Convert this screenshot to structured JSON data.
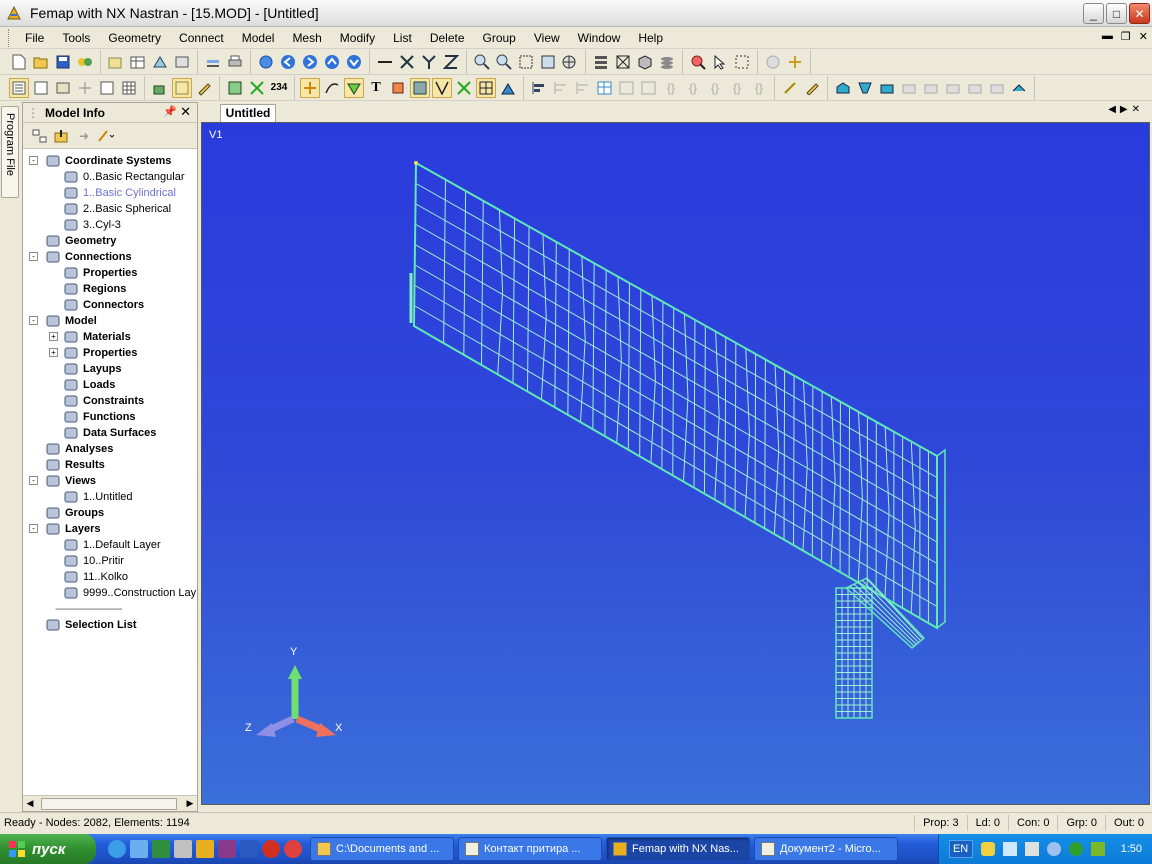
{
  "window": {
    "title": "Femap with NX Nastran - [15.MOD] - [Untitled]",
    "btn_min": "_",
    "btn_max": "□",
    "btn_close": "✕"
  },
  "menu": [
    "File",
    "Tools",
    "Geometry",
    "Connect",
    "Model",
    "Mesh",
    "Modify",
    "List",
    "Delete",
    "Group",
    "View",
    "Window",
    "Help"
  ],
  "model_info": {
    "title": "Model Info",
    "program_file_tab": "Program File",
    "tree": [
      {
        "label": "Coordinate Systems",
        "level": 0,
        "bold": true,
        "exp": "-",
        "icon": "axes-icon"
      },
      {
        "label": "0..Basic Rectangular",
        "level": 1,
        "bold": false,
        "icon": "globe-icon"
      },
      {
        "label": "1..Basic Cylindrical",
        "level": 1,
        "bold": false,
        "icon": "globe-icon",
        "highlight": true
      },
      {
        "label": "2..Basic Spherical",
        "level": 1,
        "bold": false,
        "icon": "globe-icon"
      },
      {
        "label": "3..Cyl-3",
        "level": 1,
        "bold": false,
        "icon": "axes-icon"
      },
      {
        "label": "Geometry",
        "level": 0,
        "bold": true,
        "icon": "cylinder-icon"
      },
      {
        "label": "Connections",
        "level": 0,
        "bold": true,
        "exp": "-",
        "icon": "connections-icon"
      },
      {
        "label": "Properties",
        "level": 1,
        "bold": true,
        "icon": "property-icon"
      },
      {
        "label": "Regions",
        "level": 1,
        "bold": true,
        "icon": "region-icon"
      },
      {
        "label": "Connectors",
        "level": 1,
        "bold": true,
        "icon": "connector-icon"
      },
      {
        "label": "Model",
        "level": 0,
        "bold": true,
        "exp": "-",
        "icon": "grid-icon"
      },
      {
        "label": "Materials",
        "level": 1,
        "bold": true,
        "exp": "+",
        "icon": "material-icon"
      },
      {
        "label": "Properties",
        "level": 1,
        "bold": true,
        "exp": "+",
        "icon": "beam-property-icon"
      },
      {
        "label": "Layups",
        "level": 1,
        "bold": true,
        "icon": "layup-icon"
      },
      {
        "label": "Loads",
        "level": 1,
        "bold": true,
        "icon": "load-icon"
      },
      {
        "label": "Constraints",
        "level": 1,
        "bold": true,
        "icon": "constraint-icon"
      },
      {
        "label": "Functions",
        "level": 1,
        "bold": true,
        "icon": "function-icon"
      },
      {
        "label": "Data Surfaces",
        "level": 1,
        "bold": true,
        "icon": "data-surface-icon"
      },
      {
        "label": "Analyses",
        "level": 0,
        "bold": true,
        "icon": "analysis-icon"
      },
      {
        "label": "Results",
        "level": 0,
        "bold": true,
        "icon": "results-icon"
      },
      {
        "label": "Views",
        "level": 0,
        "bold": true,
        "exp": "-",
        "icon": "views-icon"
      },
      {
        "label": "1..Untitled",
        "level": 1,
        "bold": false,
        "icon": "view-icon"
      },
      {
        "label": "Groups",
        "level": 0,
        "bold": true,
        "icon": "groups-icon"
      },
      {
        "label": "Layers",
        "level": 0,
        "bold": true,
        "exp": "-",
        "icon": "layers-icon"
      },
      {
        "label": "1..Default Layer",
        "level": 1,
        "bold": false,
        "icon": "layer-icon"
      },
      {
        "label": "10..Pritir",
        "level": 1,
        "bold": false,
        "icon": "layer-icon"
      },
      {
        "label": "11..Kolko",
        "level": 1,
        "bold": false,
        "icon": "layer-icon"
      },
      {
        "label": "9999..Construction Lay",
        "level": 1,
        "bold": false,
        "icon": "layer-icon"
      },
      {
        "label": "",
        "level": 0,
        "bold": false,
        "separator": true
      },
      {
        "label": "Selection List",
        "level": 0,
        "bold": true,
        "icon": "cursor-icon"
      }
    ],
    "separator_text": "-------------------------"
  },
  "viewport": {
    "tab": "Untitled",
    "view_label": "V1",
    "axis_x": "X",
    "axis_y": "Y",
    "axis_z": "Z",
    "colors": {
      "mesh": "#9df0d0",
      "edge": "#5fe8b8",
      "bg_top": "#2a3bdc",
      "bg_bottom": "#3a6fd9"
    }
  },
  "status": {
    "left": "Ready - Nodes: 2082,  Elements: 1194",
    "prop": "Prop: 3",
    "ld": "Ld: 0",
    "con": "Con: 0",
    "grp": "Grp: 0",
    "out": "Out: 0"
  },
  "taskbar": {
    "start": "пуск",
    "tasks": [
      "C:\\Documents and ...",
      "Контакт притира ...",
      "Femap with NX Nas...",
      "Документ2 - Micro..."
    ],
    "active_task": 2,
    "lang": "EN",
    "clock": "1:50"
  }
}
